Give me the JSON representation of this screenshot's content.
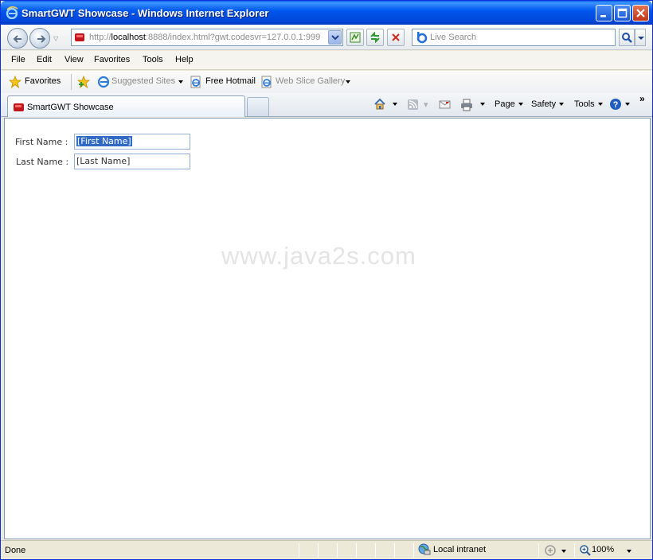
{
  "window": {
    "title": "SmartGWT Showcase - Windows Internet Explorer"
  },
  "address": {
    "url_prefix": "http://",
    "url_host": "localhost",
    "url_rest": ":8888/index.html?gwt.codesvr=127.0.0.1:999"
  },
  "search": {
    "placeholder": "Live Search"
  },
  "menu": {
    "items": [
      "File",
      "Edit",
      "View",
      "Favorites",
      "Tools",
      "Help"
    ]
  },
  "favorites": {
    "favorites_label": "Favorites",
    "suggested_sites": "Suggested Sites",
    "free_hotmail": "Free Hotmail",
    "web_slice_gallery": "Web Slice Gallery"
  },
  "tabs": {
    "active_label": "SmartGWT Showcase"
  },
  "commandbar": {
    "page": "Page",
    "safety": "Safety",
    "tools": "Tools",
    "more": "»"
  },
  "form": {
    "first_name_label": "First Name :",
    "first_name_value": "[First Name]",
    "last_name_label": "Last Name :",
    "last_name_value": "[Last Name]"
  },
  "watermark": "www.java2s.com",
  "status": {
    "text": "Done",
    "zone": "Local intranet",
    "zoom": "100%"
  },
  "colors": {
    "titlebar": "#0058ee",
    "selection": "#316ac5",
    "input_border": "#94afcf"
  }
}
